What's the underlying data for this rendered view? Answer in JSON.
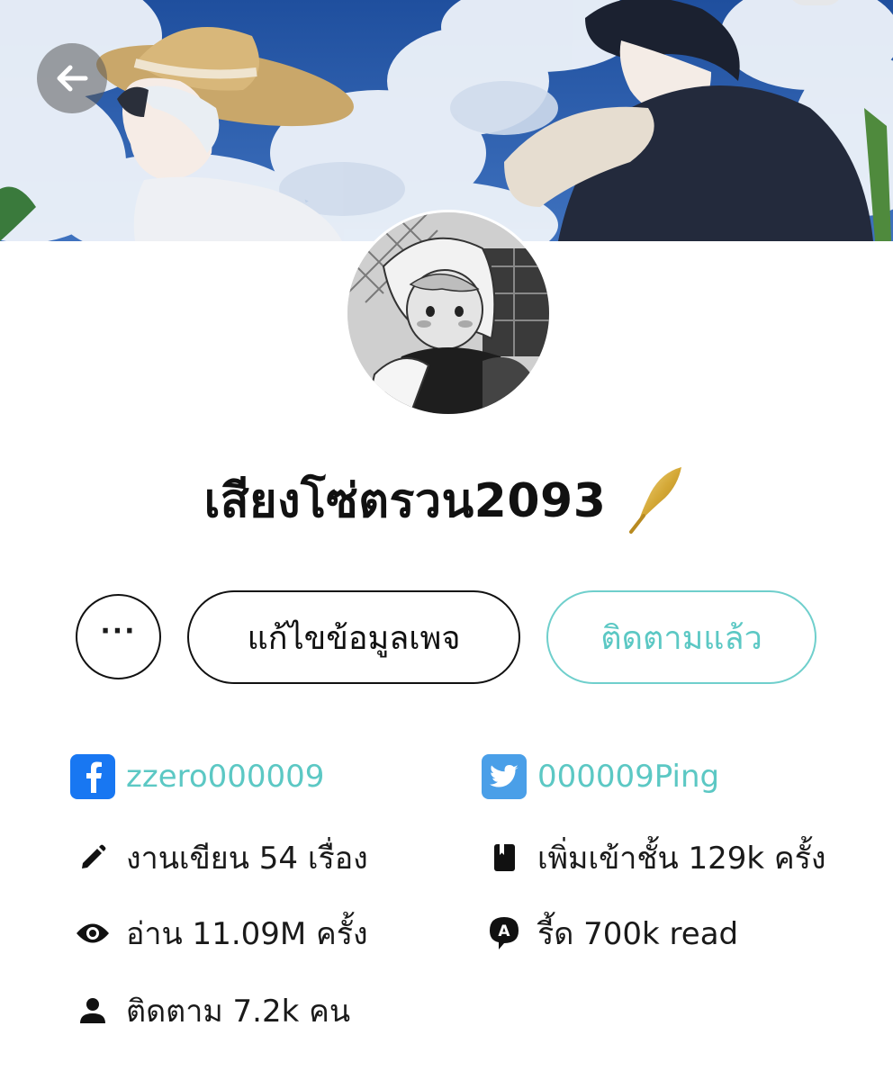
{
  "profile": {
    "name": "เสียงโซ่ตรวน2093"
  },
  "actions": {
    "more_label": "···",
    "edit_label": "แก้ไขข้อมูลเพจ",
    "follow_label": "ติดตามแล้ว"
  },
  "social": {
    "facebook": "zzero000009",
    "twitter": "000009Ping"
  },
  "stats": {
    "works": "งานเขียน 54 เรื่อง",
    "bookshelf": "เพิ่มเข้าชั้น 129k ครั้ง",
    "reads": "อ่าน 11.09M ครั้ง",
    "read_label": "รี้ด 700k read",
    "followers": "ติดตาม 7.2k คน"
  },
  "colors": {
    "accent": "#5cc8c4",
    "facebook": "#1877f2",
    "twitter": "#4a9fe8"
  }
}
